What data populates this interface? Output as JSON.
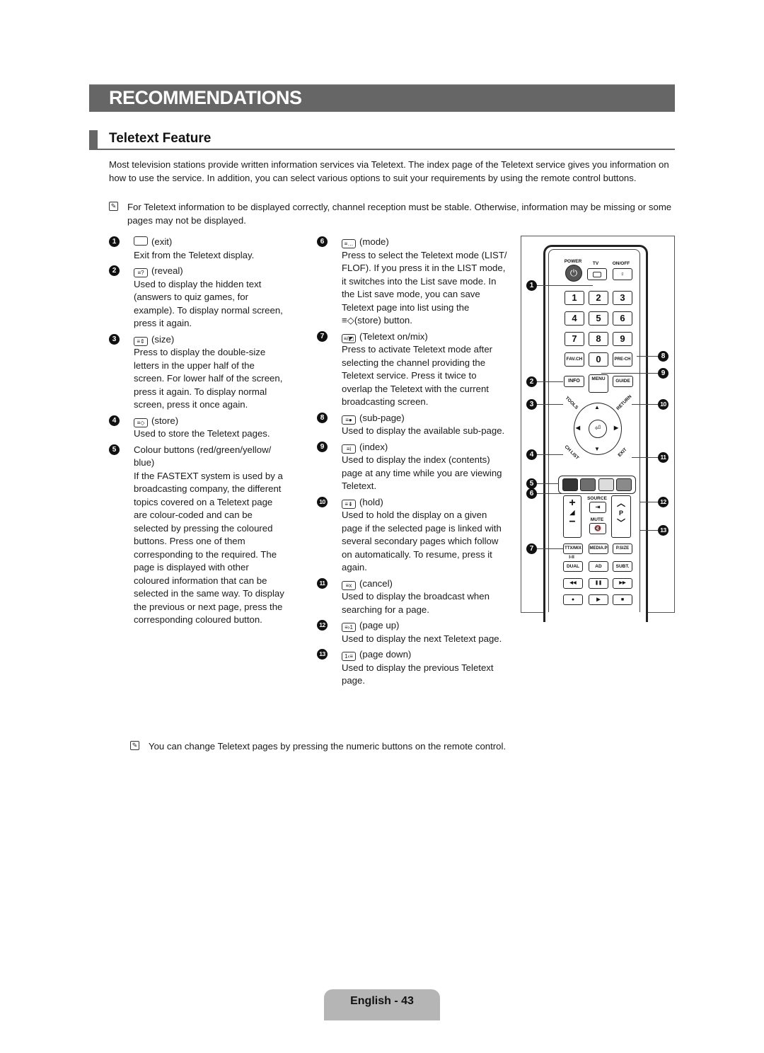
{
  "header": {
    "section_title": "RECOMMENDATIONS",
    "subsection_title": "Teletext Feature"
  },
  "intro": "Most television stations provide written information services via Teletext. The index page of the Teletext service gives you information on how to use the service. In addition, you can select various options to suit your requirements by using the remote control buttons.",
  "notes": [
    "For Teletext information to be displayed correctly, channel reception must be stable. Otherwise, information may be missing or some pages may not be displayed.",
    "You can change Teletext pages by pressing the numeric buttons on the remote control."
  ],
  "note_icon": "note-pencil-icon",
  "items": [
    {
      "num": "1",
      "icon": "exit-icon",
      "glyph": "",
      "title": "(exit)",
      "desc": "Exit from the Teletext display."
    },
    {
      "num": "2",
      "icon": "reveal-icon",
      "glyph": "≡?",
      "title": "(reveal)",
      "desc": "Used to display the hidden text (answers to quiz games, for example). To display normal screen, press it again."
    },
    {
      "num": "3",
      "icon": "size-icon",
      "glyph": "≡⇕",
      "title": "(size)",
      "desc": "Press to display the double-size letters in the upper half of the screen. For lower half of the screen, press it again. To display normal screen, press it once again."
    },
    {
      "num": "4",
      "icon": "store-icon",
      "glyph": "≡◇",
      "title": "(store)",
      "desc": "Used to store the Teletext pages."
    },
    {
      "num": "5",
      "icon": "",
      "glyph": "",
      "title": "Colour buttons (red/green/yellow/ blue)",
      "desc": "If the FASTEXT system is used by a broadcasting company, the different topics covered on a Teletext page are colour-coded and can be selected by pressing the coloured buttons. Press one of them corresponding to the required. The page is displayed with other coloured information that can be selected in the same way. To display the previous or next page, press the corresponding coloured button."
    },
    {
      "num": "6",
      "icon": "mode-icon",
      "glyph": "≡…",
      "title": "(mode)",
      "desc": "Press to select the Teletext mode (LIST/ FLOF). If you press it in the LIST mode, it switches into the List save mode. In the List save mode, you can save Teletext page into list using the ≡◇(store) button."
    },
    {
      "num": "7",
      "icon": "teletext-mix-icon",
      "glyph": "≡/◩",
      "title": "(Teletext on/mix)",
      "desc": "Press to activate Teletext mode after selecting the channel providing the Teletext service. Press it twice to overlap the Teletext with the current broadcasting screen."
    },
    {
      "num": "8",
      "icon": "sub-page-icon",
      "glyph": "≡●",
      "title": "(sub-page)",
      "desc": "Used to display the available sub-page."
    },
    {
      "num": "9",
      "icon": "index-icon",
      "glyph": "≡i",
      "title": "(index)",
      "desc": "Used to display the index (contents) page at any time while you are viewing Teletext."
    },
    {
      "num": "10",
      "icon": "hold-icon",
      "glyph": "≡⇟",
      "title": "(hold)",
      "desc": "Used to hold the display on a given page if the selected page is linked with several secondary pages which follow on automatically. To resume, press it again."
    },
    {
      "num": "11",
      "icon": "cancel-icon",
      "glyph": "≡x",
      "title": "(cancel)",
      "desc": "Used to display the broadcast when searching for a page."
    },
    {
      "num": "12",
      "icon": "page-up-icon",
      "glyph": "≡›1",
      "title": "(page up)",
      "desc": "Used to display the next Teletext page."
    },
    {
      "num": "13",
      "icon": "page-down-icon",
      "glyph": "1‹≡",
      "title": "(page down)",
      "desc": "Used to display the previous Teletext page."
    }
  ],
  "remote": {
    "labels": {
      "power": "POWER",
      "tv": "TV",
      "onoff": "ON/OFF",
      "digits": [
        "1",
        "2",
        "3",
        "4",
        "5",
        "6",
        "7",
        "8",
        "9"
      ],
      "favch": "FAV.CH",
      "zero": "0",
      "prech": "PRE-CH",
      "info": "INFO",
      "menu": "MENU",
      "guide": "GUIDE",
      "tools": "TOOLS",
      "return": "RETURN",
      "chlist": "CH LIST",
      "exit": "EXIT",
      "source": "SOURCE",
      "mute": "MUTE",
      "p": "P",
      "ttxmix": "TTX/MIX",
      "mediap": "MEDIA.P",
      "psize": "P.SIZE",
      "dual_top": "I-II",
      "dual": "DUAL",
      "ad": "AD",
      "subt": "SUBT.",
      "rew": "◀◀",
      "pause": "❚❚",
      "ff": "▶▶",
      "rec": "●",
      "play": "▶",
      "stop": "■",
      "up": "▲",
      "down": "▼",
      "left": "◀",
      "right": "▶",
      "enter": "⏎",
      "vol_plus": "+",
      "vol_minus": "−",
      "ch_up": "︿",
      "ch_down": "﹀"
    },
    "colour_buttons": [
      "#333333",
      "#6e6e6e",
      "#dcdcdc",
      "#8a8a8a"
    ]
  },
  "footer": {
    "page_label": "English - 43"
  }
}
